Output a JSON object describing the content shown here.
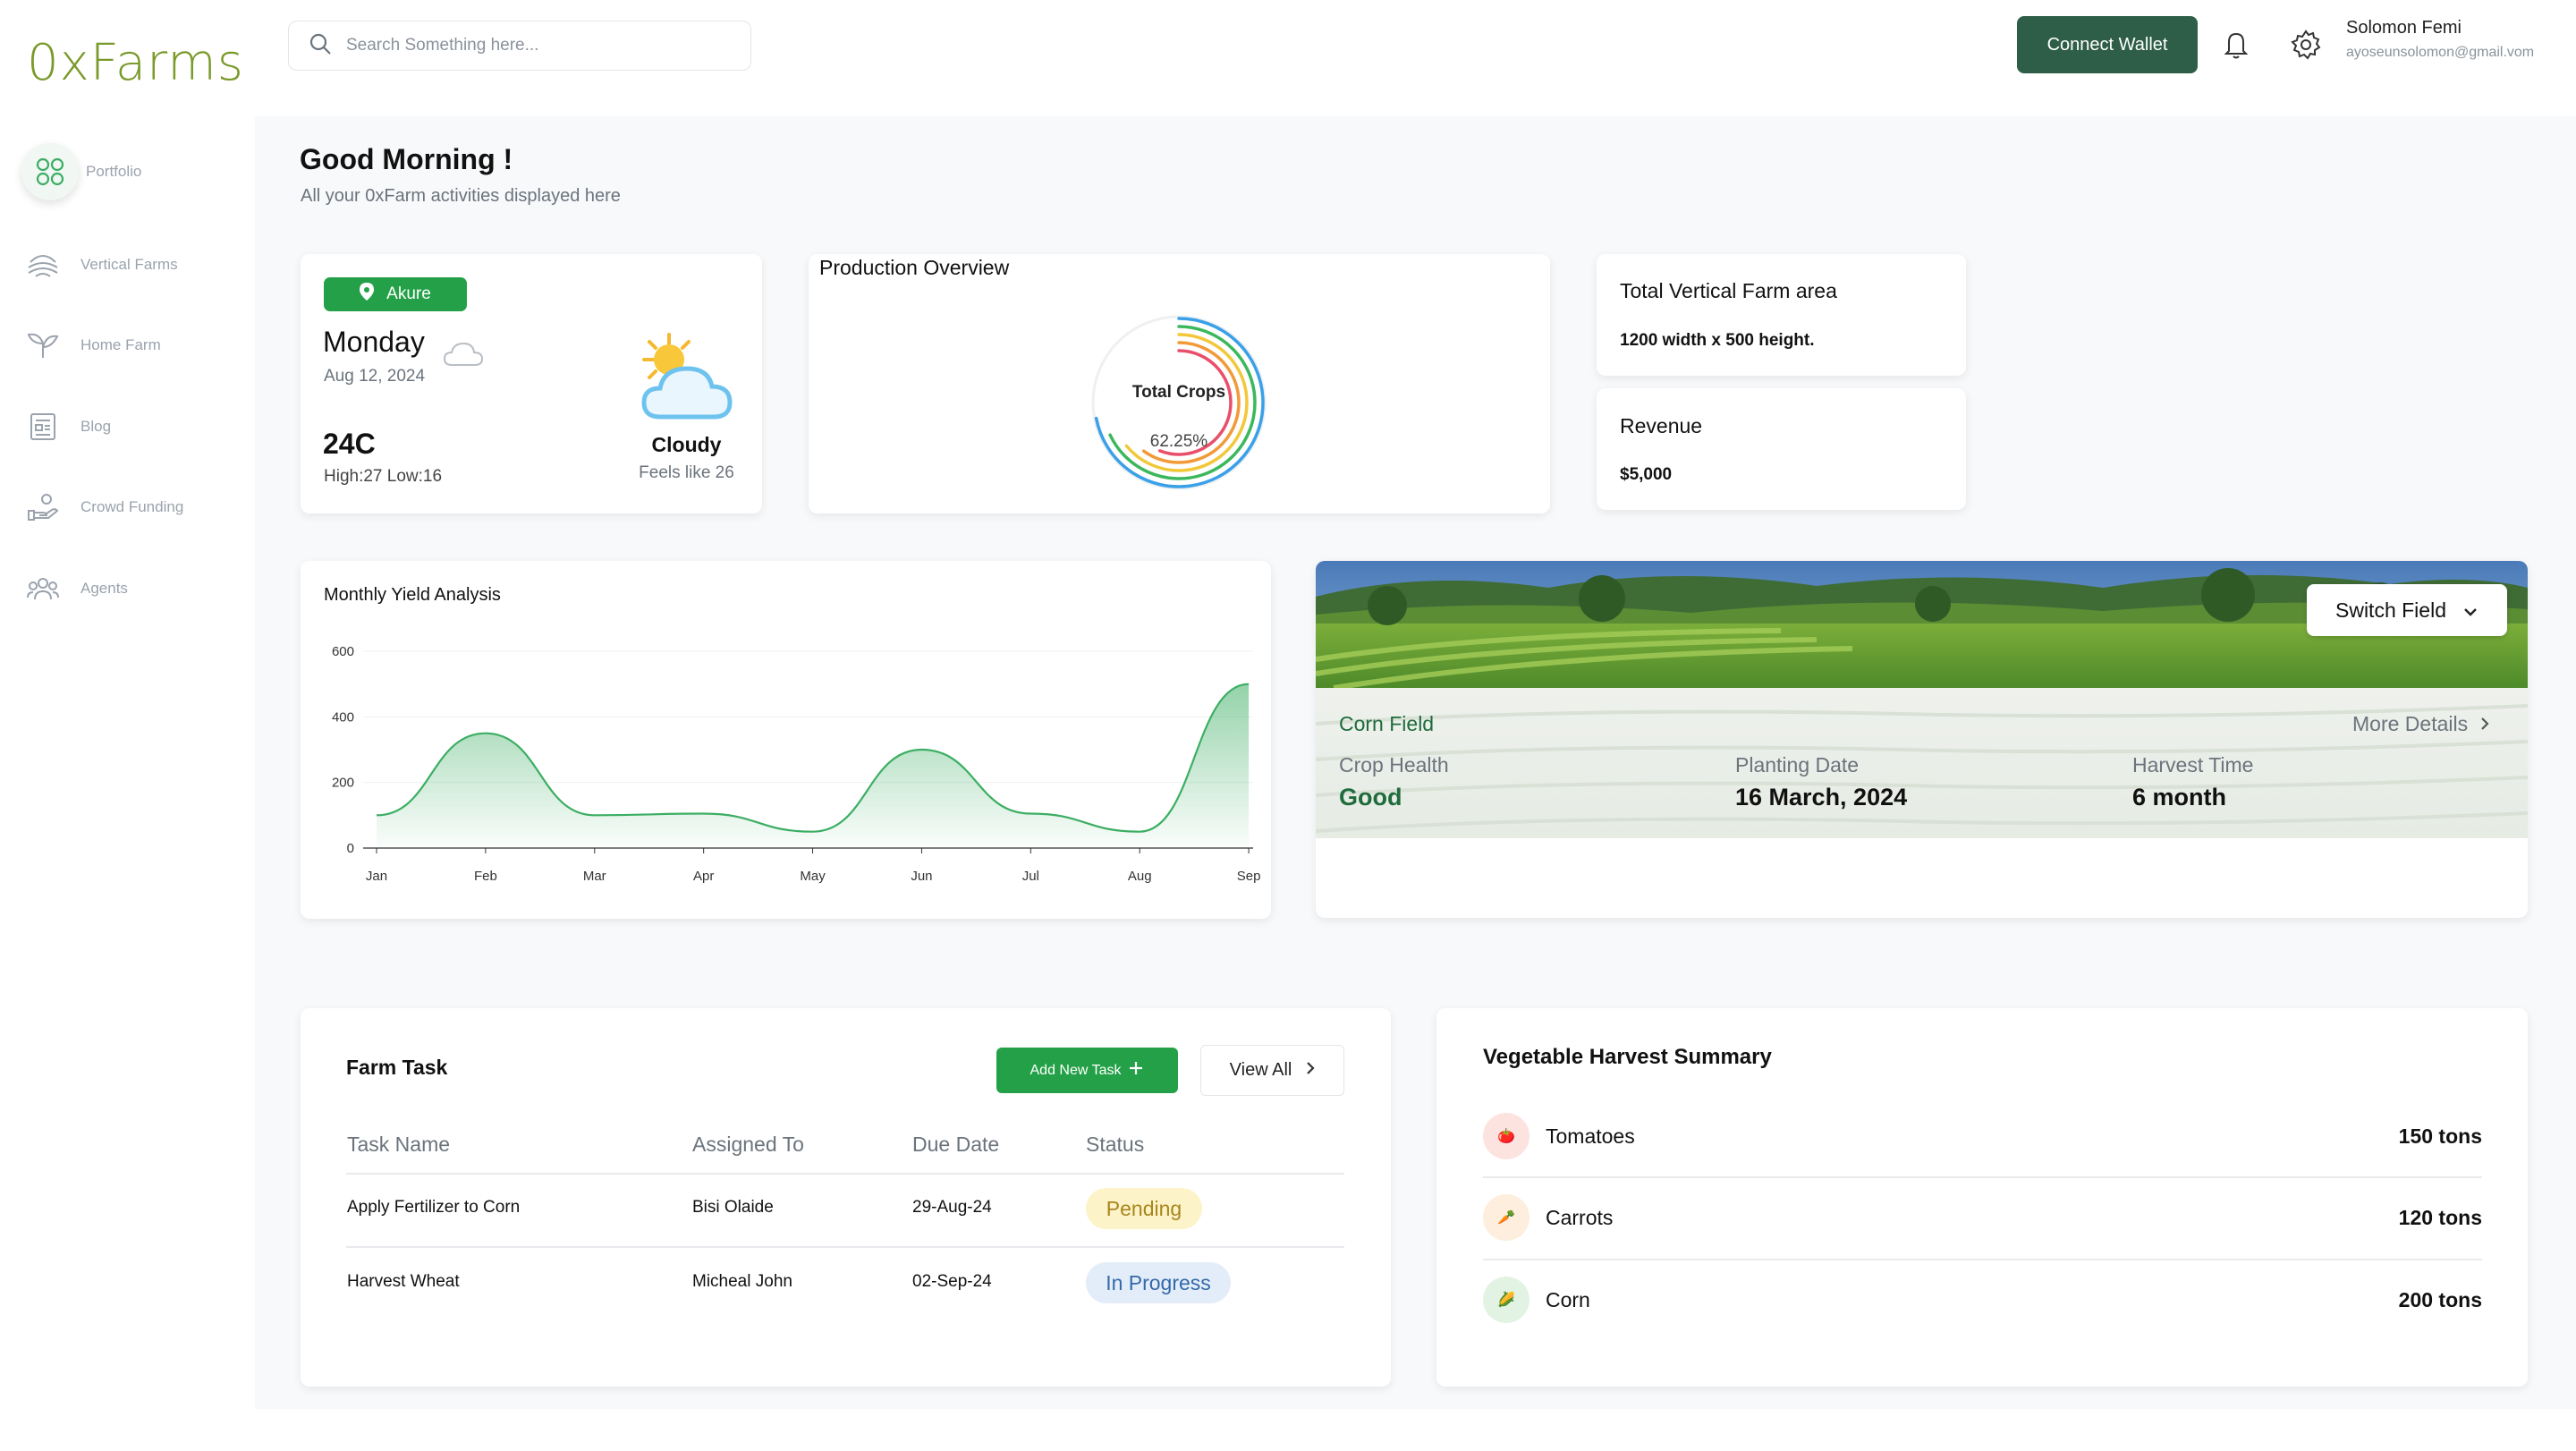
{
  "app": {
    "logo": "0xFarms"
  },
  "sidebar": {
    "items": [
      {
        "label": "Portfolio",
        "active": true
      },
      {
        "label": "Vertical Farms"
      },
      {
        "label": "Home Farm"
      },
      {
        "label": "Blog"
      },
      {
        "label": "Crowd Funding"
      },
      {
        "label": "Agents"
      }
    ]
  },
  "topbar": {
    "search_placeholder": "Search Something here...",
    "connect_wallet": "Connect Wallet",
    "user": {
      "name": "Solomon Femi",
      "email": "ayoseunsolomon@gmail.vom"
    }
  },
  "greeting": {
    "title": "Good Morning !",
    "subtitle": "All your 0xFarm activities displayed here"
  },
  "weather": {
    "location": "Akure",
    "day": "Monday",
    "date": "Aug 12, 2024",
    "temp": "24C",
    "high_low": "High:27 Low:16",
    "condition": "Cloudy",
    "feels_like": "Feels like 26"
  },
  "production": {
    "title": "Production Overview",
    "center_label": "Total Crops",
    "center_value": "62.25%",
    "rings": [
      {
        "color": "#3aa0e8",
        "fraction": 0.72
      },
      {
        "color": "#3cb85c",
        "fraction": 0.68
      },
      {
        "color": "#f2c83a",
        "fraction": 0.64
      },
      {
        "color": "#f29a38",
        "fraction": 0.6
      },
      {
        "color": "#e94f6a",
        "fraction": 0.56
      }
    ]
  },
  "farm_area": {
    "title": "Total Vertical Farm area",
    "value": "1200 width x 500 height."
  },
  "revenue": {
    "title": "Revenue",
    "value": "$5,000"
  },
  "yield": {
    "title": "Monthly Yield Analysis"
  },
  "chart_data": {
    "type": "area",
    "title": "Monthly Yield Analysis",
    "categories": [
      "Jan",
      "Feb",
      "Mar",
      "Apr",
      "May",
      "Jun",
      "Jul",
      "Aug",
      "Sep"
    ],
    "values": [
      100,
      350,
      100,
      105,
      50,
      300,
      105,
      50,
      500
    ],
    "y_ticks": [
      "0",
      "200",
      "400",
      "600"
    ],
    "ylim": [
      0,
      600
    ],
    "grid": true,
    "color": "#3cae63"
  },
  "field": {
    "switch_label": "Switch Field",
    "name": "Corn Field",
    "more_details": "More Details",
    "stats": [
      {
        "label": "Crop Health",
        "value": "Good"
      },
      {
        "label": "Planting Date",
        "value": "16 March, 2024"
      },
      {
        "label": "Harvest Time",
        "value": "6 month"
      }
    ]
  },
  "tasks": {
    "title": "Farm Task",
    "add_label": "Add New Task",
    "view_all": "View All",
    "columns": [
      "Task Name",
      "Assigned To",
      "Due Date",
      "Status"
    ],
    "rows": [
      {
        "name": "Apply Fertilizer to Corn",
        "assigned": "Bisi Olaide",
        "due": "29-Aug-24",
        "status": "Pending"
      },
      {
        "name": "Harvest Wheat",
        "assigned": "Micheal John",
        "due": "02-Sep-24",
        "status": "In Progress"
      }
    ],
    "status_colors": {
      "pending_bg": "#fdf3c8",
      "pending_fg": "#a8861c",
      "progress_bg": "#e3edf9",
      "progress_fg": "#3569a8"
    }
  },
  "harvest": {
    "title": "Vegetable Harvest Summary",
    "items": [
      {
        "name": "Tomatoes",
        "value": "150 tons",
        "icon": "tomato-icon",
        "glyph": "🍅"
      },
      {
        "name": "Carrots",
        "value": "120 tons",
        "icon": "carrot-icon",
        "glyph": "🥕"
      },
      {
        "name": "Corn",
        "value": "200 tons",
        "icon": "corn-icon",
        "glyph": "🌽"
      }
    ]
  }
}
